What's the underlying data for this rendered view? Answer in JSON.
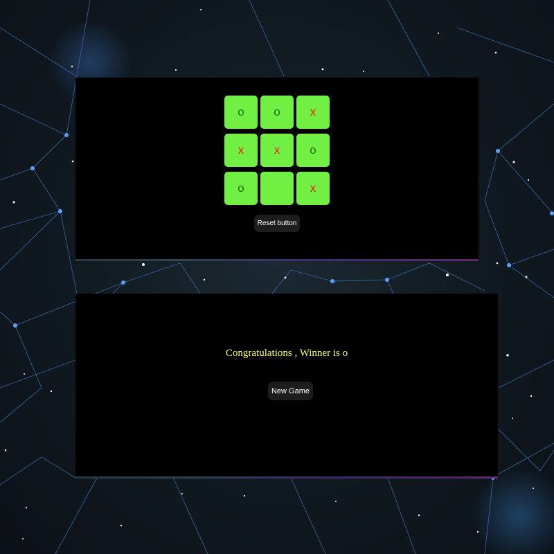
{
  "game": {
    "board": [
      "o",
      "o",
      "x",
      "x",
      "x",
      "o",
      "o",
      "",
      "x"
    ],
    "colors": {
      "cell_bg": "#71f043",
      "o_mark": "#1f6e12",
      "x_mark": "#f01a00"
    },
    "reset_label": "Reset button"
  },
  "result": {
    "message": "Congratulations , Winner is o",
    "message_color": "#ffff66",
    "new_game_label": "New Game"
  }
}
